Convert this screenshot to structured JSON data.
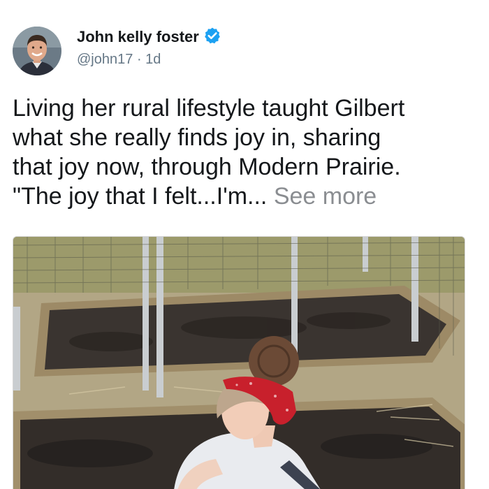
{
  "tweet": {
    "author": {
      "name": "John kelly foster",
      "handle": "@john17",
      "verified": true,
      "avatar_icon": "profile-photo"
    },
    "separator": "·",
    "timestamp": "1d",
    "text_lines": [
      "Living her rural lifestyle taught Gilbert",
      "what she really finds joy in, sharing",
      "that joy now, through Modern Prairie.",
      "\"The joy that I felt...I'm..."
    ],
    "see_more_label": "See more",
    "media": {
      "icon": "garden-photo"
    }
  },
  "colors": {
    "verified_blue": "#1da1f2",
    "secondary_text": "#657786",
    "see_more": "#8a8d91"
  }
}
